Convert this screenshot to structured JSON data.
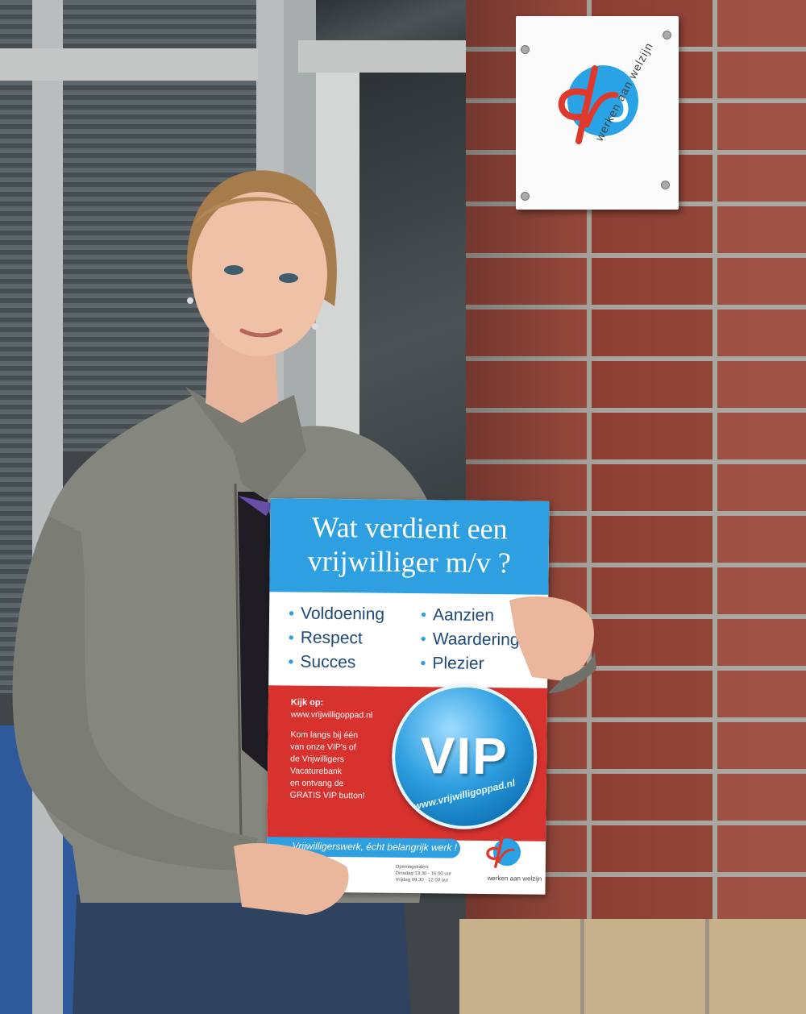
{
  "photo": {
    "wall_sign": {
      "tagline": "werken aan welzijn"
    },
    "poster": {
      "headline_line1": "Wat verdient een",
      "headline_line2": "vrijwilliger m/v ?",
      "benefits_left": [
        "Voldoening",
        "Respect",
        "Succes"
      ],
      "benefits_right": [
        "Aanzien",
        "Waardering",
        "Plezier"
      ],
      "kijk_op": "Kijk op:",
      "website": "www.vrijwilligoppad.nl",
      "body_lines": [
        "Kom langs bij één",
        "van onze VIP's of",
        "de Vrijwilligers",
        "Vacaturebank",
        "en ontvang de",
        "GRATIS VIP button!"
      ],
      "vip": "VIP",
      "vip_url": "www.vrijwilligoppad.nl",
      "slogan": "Vrijwilligerswerk, écht belangrijk werk !",
      "footer_tagline": "werken aan welzijn",
      "openingstijden_label": "Openingstijden:",
      "openingstijden_line1": "Dinsdag 13.30 - 16.00 uur",
      "openingstijden_line2": "Vrijdag 09.30 - 12.00 uur"
    },
    "colors": {
      "poster_blue": "#2e9fe0",
      "poster_red": "#d8322e",
      "logo_red": "#e0392c",
      "logo_blue": "#2aa3e6"
    }
  }
}
